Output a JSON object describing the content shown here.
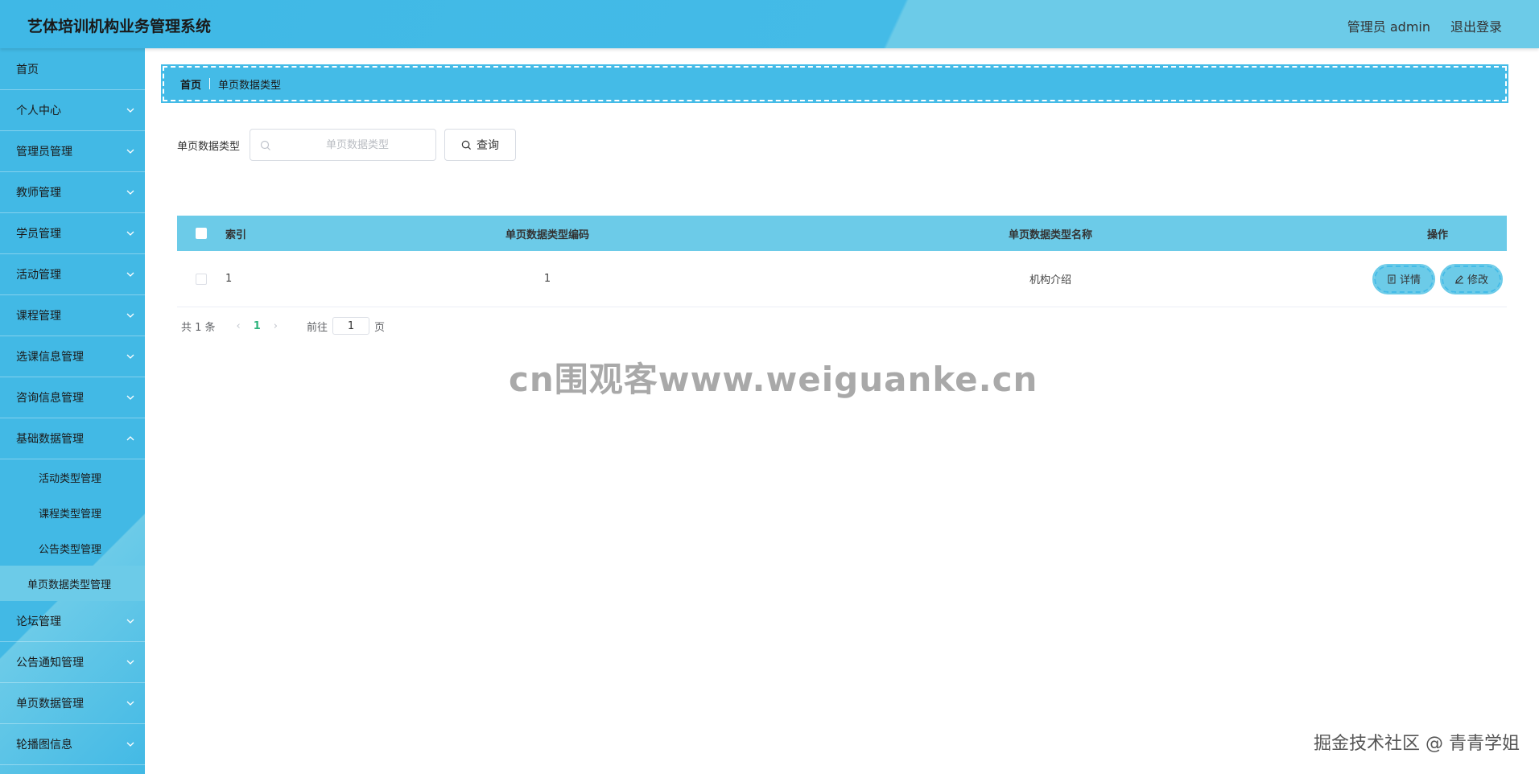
{
  "header": {
    "title": "艺体培训机构业务管理系统",
    "admin": "管理员 admin",
    "logout": "退出登录"
  },
  "sidebar": {
    "items": [
      {
        "label": "首页"
      },
      {
        "label": "个人中心"
      },
      {
        "label": "管理员管理"
      },
      {
        "label": "教师管理"
      },
      {
        "label": "学员管理"
      },
      {
        "label": "活动管理"
      },
      {
        "label": "课程管理"
      },
      {
        "label": "选课信息管理"
      },
      {
        "label": "咨询信息管理"
      },
      {
        "label": "基础数据管理"
      },
      {
        "label": "论坛管理"
      },
      {
        "label": "公告通知管理"
      },
      {
        "label": "单页数据管理"
      },
      {
        "label": "轮播图信息"
      }
    ],
    "sub_items": [
      {
        "label": "活动类型管理"
      },
      {
        "label": "课程类型管理"
      },
      {
        "label": "公告类型管理"
      },
      {
        "label": "单页数据类型管理"
      }
    ]
  },
  "breadcrumb": {
    "home": "首页",
    "current": "单页数据类型"
  },
  "search": {
    "label": "单页数据类型",
    "placeholder": "单页数据类型",
    "button": "查询"
  },
  "table": {
    "columns": [
      "索引",
      "单页数据类型编码",
      "单页数据类型名称",
      "操作"
    ],
    "rows": [
      {
        "index": "1",
        "code": "1",
        "name": "机构介绍"
      }
    ],
    "actions": {
      "detail": "详情",
      "edit": "修改"
    }
  },
  "pagination": {
    "total": "共 1 条",
    "current_page": "1",
    "goto_label": "前往",
    "goto_value": "1",
    "unit": "页"
  },
  "watermarks": {
    "center": "cn围观客www.weiguanke.cn",
    "corner": "掘金技术社区 @ 青青学姐"
  },
  "colors": {
    "primary": "#44bbe7",
    "light": "#6ccbe8",
    "page_active": "#2fb47d"
  }
}
